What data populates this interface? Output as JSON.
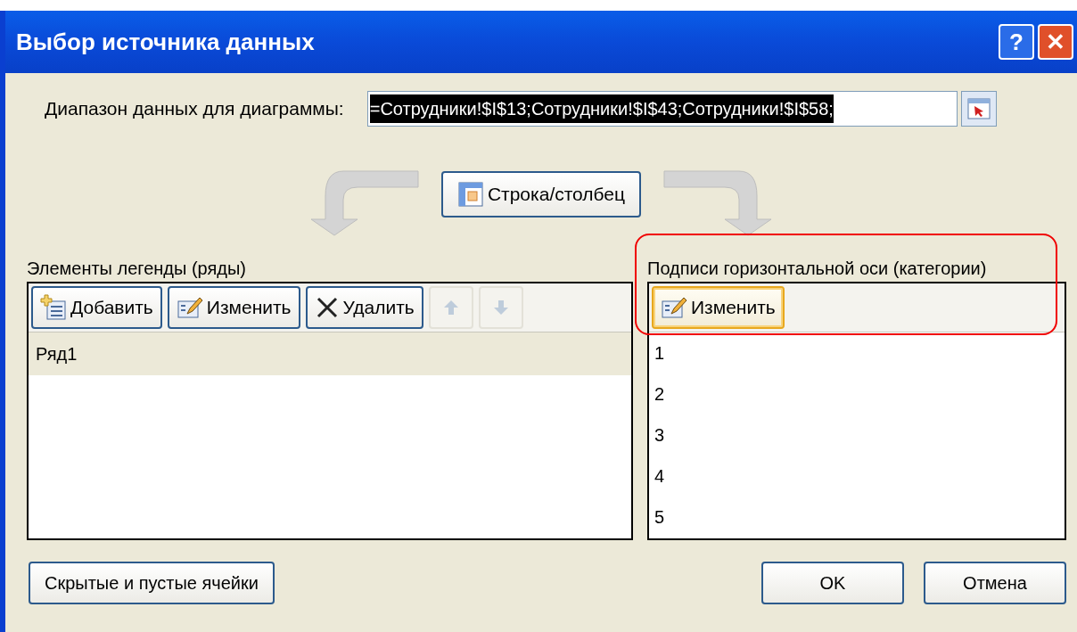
{
  "window": {
    "title": "Выбор источника данных",
    "buttons": [
      {
        "kind": "help",
        "label": "?"
      },
      {
        "kind": "close",
        "label": "✕"
      }
    ]
  },
  "range": {
    "label": "Диапазон данных для диаграммы:",
    "value": "=Сотрудники!$I$13;Сотрудники!$I$43;Сотрудники!$I$58;"
  },
  "swap_button": "Строка/столбец",
  "legend": {
    "title": "Элементы легенды (ряды)",
    "toolbar": [
      {
        "kind": "add",
        "label": "Добавить",
        "disabled": false
      },
      {
        "kind": "edit",
        "label": "Изменить",
        "disabled": false
      },
      {
        "kind": "delete",
        "label": "Удалить",
        "disabled": false
      },
      {
        "kind": "up",
        "disabled": true
      },
      {
        "kind": "down",
        "disabled": true
      }
    ],
    "items": [
      {
        "label": "Ряд1",
        "selected": true
      }
    ]
  },
  "axis": {
    "title": "Подписи горизонтальной оси (категории)",
    "highlighted": true,
    "toolbar": [
      {
        "kind": "edit",
        "label": "Изменить",
        "focused": true
      }
    ],
    "items": [
      {
        "label": "1"
      },
      {
        "label": "2"
      },
      {
        "label": "3"
      },
      {
        "label": "4"
      },
      {
        "label": "5"
      }
    ]
  },
  "footer": {
    "hidden_cells_button": "Скрытые и пустые ячейки",
    "ok": "OK",
    "cancel": "Отмена"
  }
}
